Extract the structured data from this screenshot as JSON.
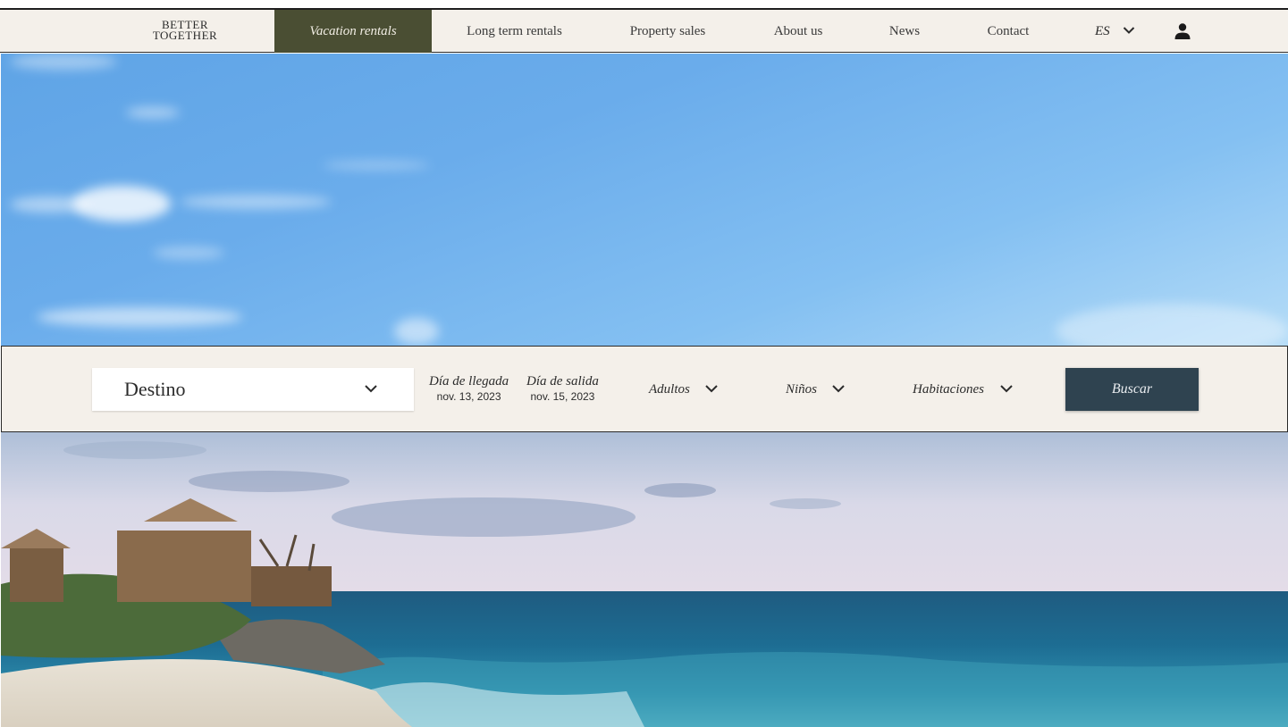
{
  "logo": {
    "line1": "BETTER",
    "line2": "TOGETHER"
  },
  "nav": {
    "items": [
      {
        "label": "Vacation rentals",
        "active": true
      },
      {
        "label": "Long term rentals",
        "active": false
      },
      {
        "label": "Property sales",
        "active": false
      },
      {
        "label": "About us",
        "active": false
      },
      {
        "label": "News",
        "active": false
      },
      {
        "label": "Contact",
        "active": false
      }
    ],
    "language": "ES",
    "user_icon": "user-icon"
  },
  "search": {
    "destination_label": "Destino",
    "arrival_label": "Día de llegada",
    "arrival_date": "nov. 13, 2023",
    "departure_label": "Día de salida",
    "departure_date": "nov. 15, 2023",
    "adults_label": "Adultos",
    "children_label": "Niños",
    "rooms_label": "Habitaciones",
    "submit_label": "Buscar"
  },
  "colors": {
    "nav_background": "#f4f0ea",
    "nav_active": "#4a4e33",
    "search_button": "#2f4350"
  }
}
